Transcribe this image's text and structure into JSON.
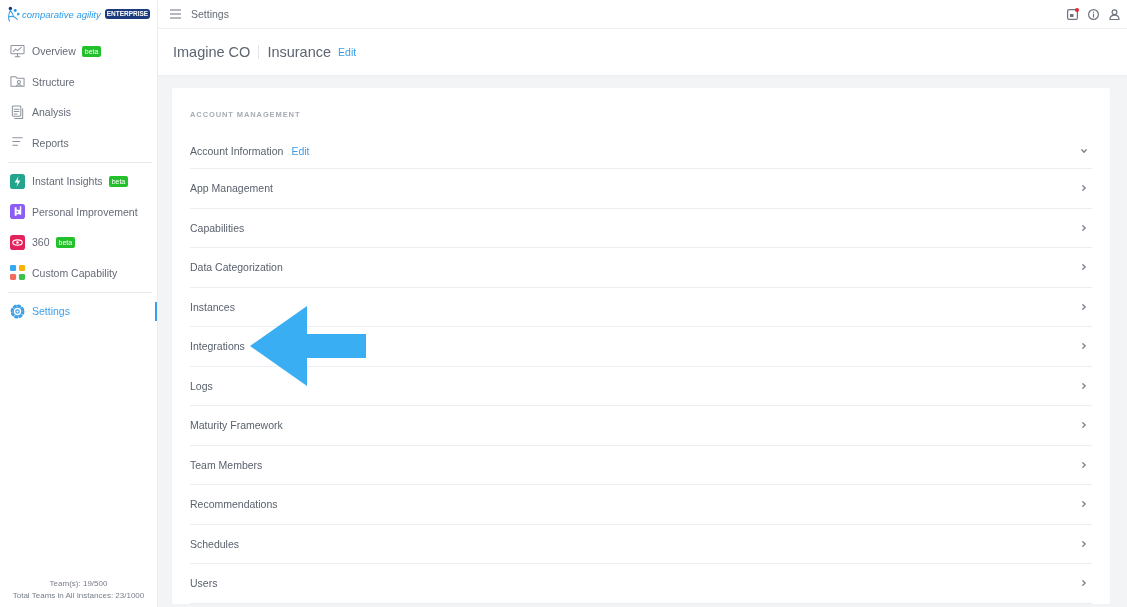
{
  "logo": {
    "name": "comparative agility",
    "edition": "ENTERPRISE"
  },
  "sidebar": {
    "sections": [
      {
        "items": [
          {
            "label": "Overview",
            "badge": "beta",
            "selected": false
          },
          {
            "label": "Structure",
            "selected": false
          },
          {
            "label": "Analysis",
            "selected": false
          },
          {
            "label": "Reports",
            "selected": false
          }
        ]
      },
      {
        "items": [
          {
            "label": "Instant Insights",
            "badge": "beta",
            "selected": false
          },
          {
            "label": "Personal Improvement",
            "selected": false
          },
          {
            "label": "360",
            "badge": "beta",
            "selected": false
          },
          {
            "label": "Custom Capability",
            "selected": false
          }
        ]
      },
      {
        "items": [
          {
            "label": "Settings",
            "selected": true
          }
        ]
      }
    ],
    "footer": [
      "Team(s): 19/500",
      "Total Teams in All Instances: 23/1000"
    ]
  },
  "topbar": {
    "title": "Settings",
    "has_unread": true
  },
  "header": {
    "organization": "Imagine CO",
    "instance": "Insurance",
    "edit_link": "Edit"
  },
  "account_management": {
    "heading": "ACCOUNT MANAGEMENT",
    "rows": [
      {
        "label": "Account Information",
        "edit_link": "Edit",
        "expanded": true,
        "pointed_at": false
      },
      {
        "label": "App Management",
        "expanded": false,
        "pointed_at": false
      },
      {
        "label": "Capabilities",
        "expanded": false,
        "pointed_at": false
      },
      {
        "label": "Data Categorization",
        "expanded": false,
        "pointed_at": false
      },
      {
        "label": "Instances",
        "expanded": false,
        "pointed_at": false
      },
      {
        "label": "Integrations",
        "expanded": false,
        "pointed_at": true
      },
      {
        "label": "Logs",
        "expanded": false,
        "pointed_at": false
      },
      {
        "label": "Maturity Framework",
        "expanded": false,
        "pointed_at": false
      },
      {
        "label": "Team Members",
        "expanded": false,
        "pointed_at": false
      },
      {
        "label": "Recommendations",
        "expanded": false,
        "pointed_at": false
      },
      {
        "label": "Schedules",
        "expanded": false,
        "pointed_at": false
      },
      {
        "label": "Users",
        "expanded": false,
        "pointed_at": false
      }
    ]
  }
}
